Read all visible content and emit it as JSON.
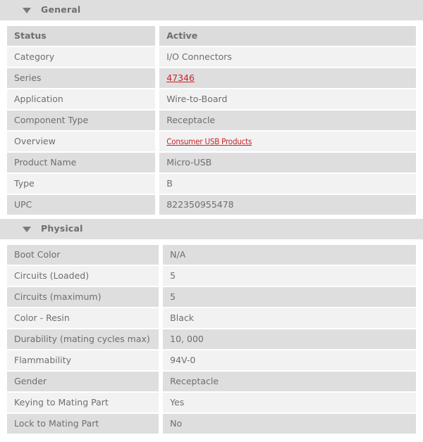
{
  "colors": {
    "section_band": "#dedede",
    "row_dark": "#dedede",
    "row_light": "#f2f2f2",
    "header_row": "#dcdcdc",
    "text": "#6d6e71",
    "link": "#cc2229",
    "page_background": "#ffffff"
  },
  "sections": [
    {
      "id": "general",
      "title": "General",
      "caret_icon": "caret-down-icon",
      "expanded": true,
      "header_row": {
        "label": "Status",
        "value": "Active"
      },
      "rows": [
        {
          "label": "Category",
          "value": "I/O Connectors",
          "link": false
        },
        {
          "label": "Series",
          "value": "47346",
          "link": true,
          "condensed": false
        },
        {
          "label": "Application",
          "value": "Wire-to-Board",
          "link": false
        },
        {
          "label": "Component Type",
          "value": "Receptacle",
          "link": false
        },
        {
          "label": "Overview",
          "value": "Consumer USB Products",
          "link": true,
          "condensed": true
        },
        {
          "label": "Product Name",
          "value": "Micro-USB",
          "link": false
        },
        {
          "label": "Type",
          "value": "B",
          "link": false
        },
        {
          "label": "UPC",
          "value": "822350955478",
          "link": false
        }
      ]
    },
    {
      "id": "physical",
      "title": "Physical",
      "caret_icon": "caret-down-icon",
      "expanded": true,
      "header_row": null,
      "rows": [
        {
          "label": "Boot Color",
          "value": "N/A",
          "link": false
        },
        {
          "label": "Circuits (Loaded)",
          "value": "5",
          "link": false
        },
        {
          "label": "Circuits (maximum)",
          "value": "5",
          "link": false
        },
        {
          "label": "Color - Resin",
          "value": "Black",
          "link": false
        },
        {
          "label": "Durability (mating cycles max)",
          "value": "10, 000",
          "link": false
        },
        {
          "label": "Flammability",
          "value": "94V-0",
          "link": false
        },
        {
          "label": "Gender",
          "value": "Receptacle",
          "link": false
        },
        {
          "label": "Keying to Mating Part",
          "value": "Yes",
          "link": false
        },
        {
          "label": "Lock to Mating Part",
          "value": "No",
          "link": false
        }
      ]
    }
  ]
}
